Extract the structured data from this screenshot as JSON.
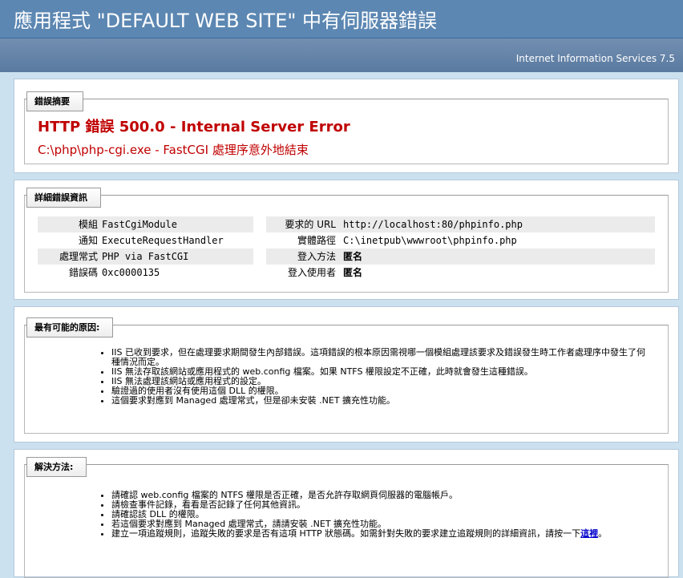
{
  "header": {
    "title": "應用程式 \"DEFAULT WEB SITE\" 中有伺服器錯誤",
    "product": "Internet Information Services 7.5"
  },
  "summary": {
    "legend": "錯誤摘要",
    "error_title": "HTTP 錯誤 500.0 - Internal Server Error",
    "error_detail": "C:\\php\\php-cgi.exe - FastCGI 處理序意外地結束"
  },
  "details": {
    "legend": "詳細錯誤資訊",
    "left": [
      {
        "label": "模組",
        "value": "FastCgiModule"
      },
      {
        "label": "通知",
        "value": "ExecuteRequestHandler"
      },
      {
        "label": "處理常式",
        "value": "PHP via FastCGI"
      },
      {
        "label": "錯誤碼",
        "value": "0xc0000135"
      }
    ],
    "right": [
      {
        "label": "要求的 URL",
        "value": "http://localhost:80/phpinfo.php"
      },
      {
        "label": "實體路徑",
        "value": "C:\\inetpub\\wwwroot\\phpinfo.php"
      },
      {
        "label": "登入方法",
        "value": "匿名"
      },
      {
        "label": "登入使用者",
        "value": "匿名"
      }
    ]
  },
  "causes": {
    "legend": "最有可能的原因:",
    "items": [
      "IIS 已收到要求，但在處理要求期間發生內部錯誤。這項錯誤的根本原因需視哪一個模組處理該要求及錯誤發生時工作者處理序中發生了何種情況而定。",
      "IIS 無法存取該網站或應用程式的 web.config 檔案。如果 NTFS 權限設定不正確，此時就會發生這種錯誤。",
      "IIS 無法處理該網站或應用程式的設定。",
      "驗證過的使用者沒有使用這個 DLL 的權限。",
      "這個要求對應到 Managed 處理常式，但是卻未安裝 .NET 擴充性功能。"
    ]
  },
  "solutions": {
    "legend": "解決方法:",
    "items": [
      "請確認 web.config 檔案的 NTFS 權限是否正確，是否允許存取網頁伺服器的電腦帳戶。",
      "請檢查事件記錄，看看是否記錄了任何其他資訊。",
      "請確認該 DLL 的權限。",
      "若這個要求對應到 Managed 處理常式，請請安裝 .NET 擴充性功能。"
    ],
    "last_item_text": "建立一項追蹤規則，追蹤失敗的要求是否有這項 HTTP 狀態碼。如需針對失敗的要求建立追蹤規則的詳細資訊，請按一下",
    "link_text": "這裡",
    "last_item_end": "。"
  }
}
